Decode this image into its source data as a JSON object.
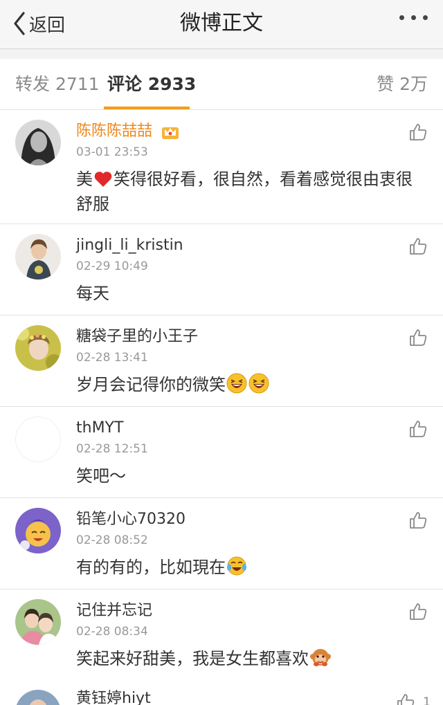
{
  "nav": {
    "back_label": "返回",
    "title": "微博正文"
  },
  "tabs": {
    "repost": "转发 2711",
    "comments": "评论 2933",
    "likes": "赞 2万"
  },
  "comments": [
    {
      "name": "陈陈陈喆喆",
      "time": "03-01 23:53",
      "text_a": "美",
      "text_b": "笑得很好看，很自然，看着感觉很由衷很舒服"
    },
    {
      "name": "jingli_li_kristin",
      "time": "02-29 10:49",
      "text": "每天"
    },
    {
      "name": "糖袋子里的小王子",
      "time": "02-28 13:41",
      "text": "岁月会记得你的微笑"
    },
    {
      "name": "thMYT",
      "time": "02-28 12:51",
      "text": "笑吧～"
    },
    {
      "name": "铅笔小心70320",
      "time": "02-28 08:52",
      "text": "有的有的，比如現在"
    },
    {
      "name": "记住并忘记",
      "time": "02-28 08:34",
      "text": "笑起来好甜美，我是女生都喜欢"
    },
    {
      "name": "黄钰婷hiyt",
      "like_count": "1"
    }
  ],
  "colors": {
    "accent": "#f39c1b",
    "vip_name": "#f08519"
  }
}
